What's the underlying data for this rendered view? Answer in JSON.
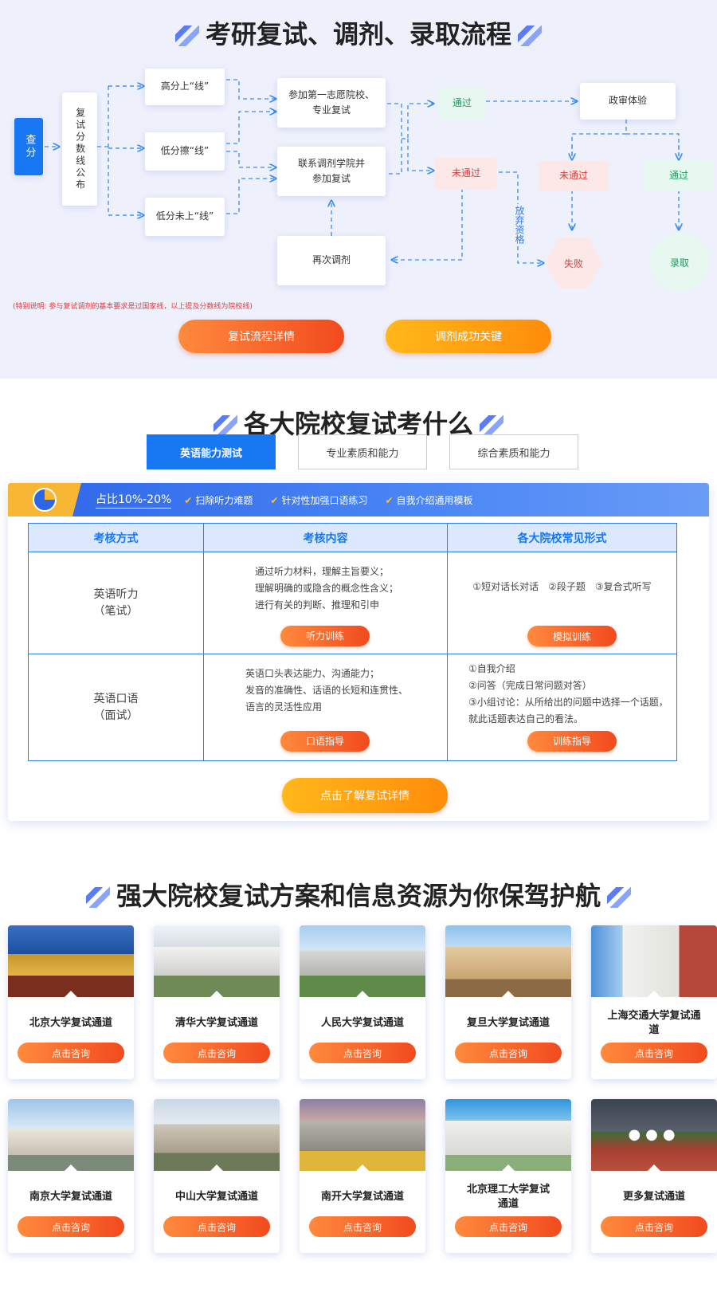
{
  "flow": {
    "title": "考研复试、调剂、录取流程",
    "nodes": {
      "check_score": "查分",
      "line_publish": "复试分数线公布",
      "high_score": "高分上“线”",
      "low_edge": "低分擦“线”",
      "low_below": "低分未上“线”",
      "first_choice": "参加第一志愿院校、专业复试",
      "contact_adjust": "联系调剂学院并参加复试",
      "readjust": "再次调剂",
      "pass1": "通过",
      "fail1": "未通过",
      "political": "政审体验",
      "fail2": "未通过",
      "pass2": "通过",
      "failure": "失败",
      "admitted": "录取",
      "give_up": "放弃资格"
    },
    "note": "(特别说明: 参与复试调剂的基本要求是过国家线，以上提及分数线为院校线)",
    "btn_process": "复试流程详情",
    "btn_key": "调剂成功关键"
  },
  "exam": {
    "title": "各大院校复试考什么",
    "tabs": [
      "英语能力测试",
      "专业素质和能力",
      "综合素质和能力"
    ],
    "banner": {
      "ratio": "占比10%-20%",
      "items": [
        "扫除听力难题",
        "针对性加强口语练习",
        "自我介绍通用模板"
      ]
    },
    "table": {
      "headers": [
        "考核方式",
        "考核内容",
        "各大院校常见形式"
      ],
      "rows": [
        {
          "method_line1": "英语听力",
          "method_line2": "（笔试）",
          "content": [
            "通过听力材料，理解主旨要义；",
            "理解明确的或隐含的概念性含义；",
            "进行有关的判断、推理和引申"
          ],
          "content_btn": "听力训练",
          "forms": [
            "①短对话长对话　②段子题　③复合式听写"
          ],
          "forms_btn": "模拟训练"
        },
        {
          "method_line1": "英语口语",
          "method_line2": "（面试）",
          "content": [
            "英语口头表达能力、沟通能力；",
            "发音的准确性、话语的长短和连贯性、",
            "语言的灵活性应用"
          ],
          "content_btn": "口语指导",
          "forms": [
            "①自我介绍",
            "②问答（完成日常问题对答）",
            "③小组讨论：从所给出的问题中选择一个话题，",
            "就此话题表达自己的看法。"
          ],
          "forms_btn": "训练指导"
        }
      ]
    },
    "detail_btn": "点击了解复试详情"
  },
  "unis": {
    "title": "强大院校复试方案和信息资源为你保驾护航",
    "btn_label": "点击咨询",
    "items": [
      {
        "name": "北京大学复试通道"
      },
      {
        "name": "清华大学复试通道"
      },
      {
        "name": "人民大学复试通道"
      },
      {
        "name": "复旦大学复试通道"
      },
      {
        "name": "上海交通大学复试通道"
      },
      {
        "name": "南京大学复试通道"
      },
      {
        "name": "中山大学复试通道"
      },
      {
        "name": "南开大学复试通道"
      },
      {
        "name": "北京理工大学复试通道"
      },
      {
        "name": "更多复试通道"
      }
    ]
  }
}
